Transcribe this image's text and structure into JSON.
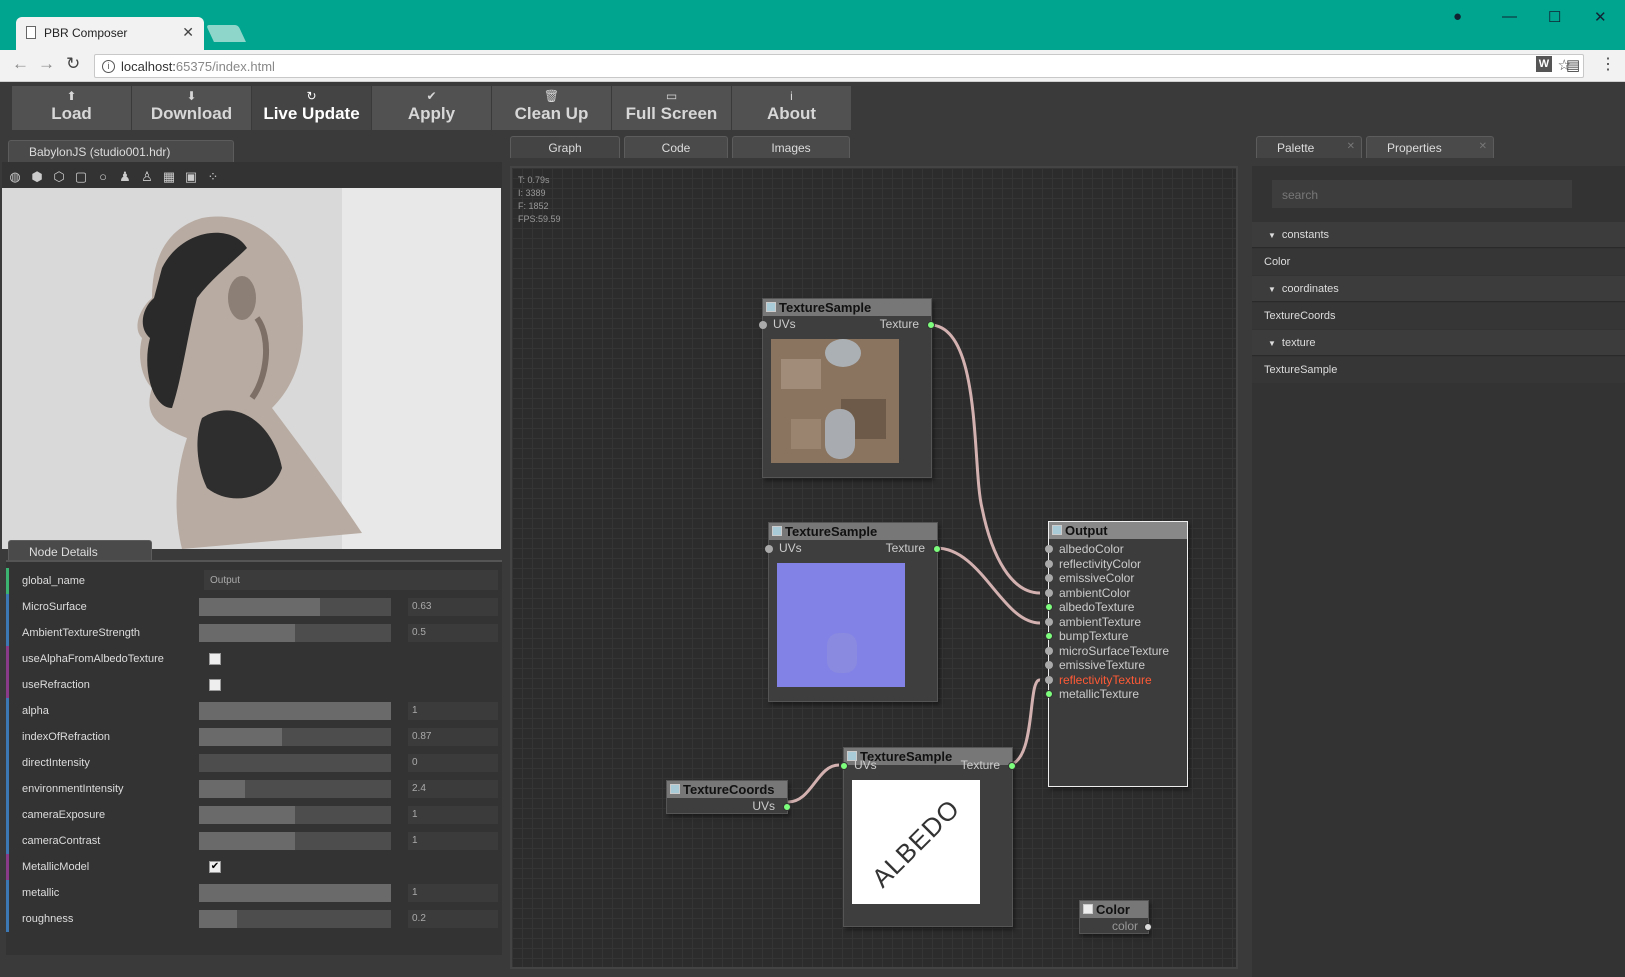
{
  "browser": {
    "tab_title": "PBR Composer",
    "url_host": "localhost:",
    "url_port": "65375/index.html"
  },
  "toolbar": [
    {
      "icon": "⬆",
      "icon_name": "upload-icon",
      "label": "Load"
    },
    {
      "icon": "⬇",
      "icon_name": "download-icon",
      "label": "Download"
    },
    {
      "icon": "↻",
      "icon_name": "refresh-icon",
      "label": "Live Update"
    },
    {
      "icon": "✔",
      "icon_name": "check-icon",
      "label": "Apply"
    },
    {
      "icon": "🗑",
      "icon_name": "trash-icon",
      "label": "Clean Up"
    },
    {
      "icon": "▭",
      "icon_name": "monitor-icon",
      "label": "Full Screen"
    },
    {
      "icon": "i",
      "icon_name": "info-icon",
      "label": "About"
    }
  ],
  "preview": {
    "tab": "BabylonJS (studio001.hdr)"
  },
  "details": {
    "tab": "Node Details",
    "rows": [
      {
        "name": "global_name",
        "type": "text",
        "value": "Output",
        "color": "#3cb371"
      },
      {
        "name": "MicroSurface",
        "type": "slider",
        "value": "0.63",
        "fill": 0.63,
        "color": "#3c78b4"
      },
      {
        "name": "AmbientTextureStrength",
        "type": "slider",
        "value": "0.5",
        "fill": 0.5,
        "color": "#3c78b4"
      },
      {
        "name": "useAlphaFromAlbedoTexture",
        "type": "checkbox",
        "checked": false,
        "color": "#8a3c8a"
      },
      {
        "name": "useRefraction",
        "type": "checkbox",
        "checked": false,
        "color": "#8a3c8a"
      },
      {
        "name": "alpha",
        "type": "slider",
        "value": "1",
        "fill": 1,
        "color": "#3c78b4"
      },
      {
        "name": "indexOfRefraction",
        "type": "slider",
        "value": "0.87",
        "fill": 0.43,
        "color": "#3c78b4"
      },
      {
        "name": "directIntensity",
        "type": "slider",
        "value": "0",
        "fill": 0,
        "color": "#3c78b4"
      },
      {
        "name": "environmentIntensity",
        "type": "slider",
        "value": "2.4",
        "fill": 0.24,
        "color": "#3c78b4"
      },
      {
        "name": "cameraExposure",
        "type": "slider",
        "value": "1",
        "fill": 0.5,
        "color": "#3c78b4"
      },
      {
        "name": "cameraContrast",
        "type": "slider",
        "value": "1",
        "fill": 0.5,
        "color": "#3c78b4"
      },
      {
        "name": "MetallicModel",
        "type": "checkbox",
        "checked": true,
        "color": "#8a3c8a"
      },
      {
        "name": "metallic",
        "type": "slider",
        "value": "1",
        "fill": 1,
        "color": "#3c78b4"
      },
      {
        "name": "roughness",
        "type": "slider",
        "value": "0.2",
        "fill": 0.2,
        "color": "#3c78b4"
      }
    ]
  },
  "graph": {
    "tabs": [
      "Graph",
      "Code",
      "Images"
    ],
    "stats": [
      "T: 0.79s",
      "I: 3389",
      "F: 1852",
      "FPS:59.59"
    ],
    "node_texture_title": "TextureSample",
    "port_uvs": "UVs",
    "port_texture": "Texture",
    "coords_title": "TextureCoords",
    "albedo_text": "ALBEDO",
    "color_title": "Color",
    "color_port": "color",
    "output": {
      "title": "Output",
      "ports": [
        {
          "label": "albedoColor",
          "active": false,
          "highlight": false
        },
        {
          "label": "reflectivityColor",
          "active": false,
          "highlight": false
        },
        {
          "label": "emissiveColor",
          "active": false,
          "highlight": false
        },
        {
          "label": "ambientColor",
          "active": false,
          "highlight": false
        },
        {
          "label": "albedoTexture",
          "active": true,
          "highlight": false
        },
        {
          "label": "ambientTexture",
          "active": false,
          "highlight": false
        },
        {
          "label": "bumpTexture",
          "active": true,
          "highlight": false
        },
        {
          "label": "microSurfaceTexture",
          "active": false,
          "highlight": false
        },
        {
          "label": "emissiveTexture",
          "active": false,
          "highlight": false
        },
        {
          "label": "reflectivityTexture",
          "active": false,
          "highlight": true
        },
        {
          "label": "metallicTexture",
          "active": true,
          "highlight": false
        }
      ]
    }
  },
  "palette": {
    "tabs": [
      "Palette",
      "Properties"
    ],
    "search_placeholder": "search",
    "categories": [
      {
        "label": "constants",
        "items": [
          "Color"
        ]
      },
      {
        "label": "coordinates",
        "items": [
          "TextureCoords"
        ]
      },
      {
        "label": "texture",
        "items": [
          "TextureSample"
        ]
      }
    ]
  }
}
